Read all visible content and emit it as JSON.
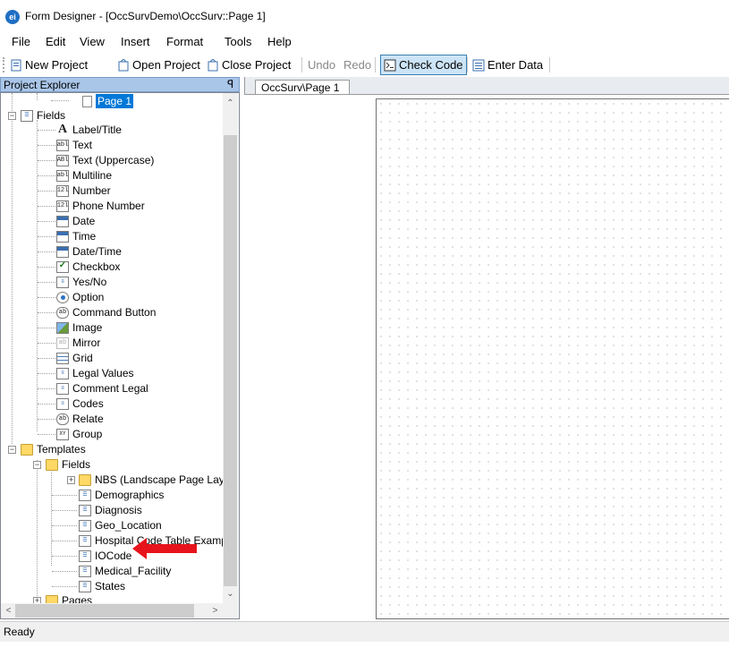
{
  "window": {
    "title": "Form Designer - [OccSurvDemo\\OccSurv::Page 1]",
    "icon_text": "ei"
  },
  "menu": [
    "File",
    "Edit",
    "View",
    "Insert",
    "Format",
    "Tools",
    "Help"
  ],
  "toolbar": {
    "new_project": "New Project",
    "open_project": "Open Project",
    "close_project": "Close Project",
    "undo": "Undo",
    "redo": "Redo",
    "check_code": "Check Code",
    "enter_data": "Enter Data"
  },
  "project_explorer": {
    "title": "Project Explorer",
    "pin": "ꟼ",
    "page_item": "Page 1",
    "fields_label": "Fields",
    "field_items": [
      {
        "icon": "A",
        "label": "Label/Title"
      },
      {
        "icon": "abl",
        "label": "Text"
      },
      {
        "icon": "ABl",
        "label": "Text (Uppercase)"
      },
      {
        "icon": "abl",
        "label": "Multiline"
      },
      {
        "icon": "12l",
        "label": "Number"
      },
      {
        "icon": "12l",
        "label": "Phone Number"
      },
      {
        "icon": "",
        "label": "Date"
      },
      {
        "icon": "",
        "label": "Time"
      },
      {
        "icon": "",
        "label": "Date/Time"
      },
      {
        "icon": "✓",
        "label": "Checkbox"
      },
      {
        "icon": "≡",
        "label": "Yes/No"
      },
      {
        "icon": "",
        "label": "Option"
      },
      {
        "icon": "ab",
        "label": "Command Button"
      },
      {
        "icon": "",
        "label": "Image"
      },
      {
        "icon": "ab",
        "label": "Mirror"
      },
      {
        "icon": "",
        "label": "Grid"
      },
      {
        "icon": "≡",
        "label": "Legal Values"
      },
      {
        "icon": "≡",
        "label": "Comment Legal"
      },
      {
        "icon": "≡",
        "label": "Codes"
      },
      {
        "icon": "ab",
        "label": "Relate"
      },
      {
        "icon": "XY",
        "label": "Group"
      }
    ],
    "templates_label": "Templates",
    "templates_fields_label": "Fields",
    "template_items": [
      "NBS (Landscape Page Layc",
      "Demographics",
      "Diagnosis",
      "Geo_Location",
      "Hospital Code Table Examp",
      "IOCode",
      "Medical_Facility",
      "States"
    ],
    "pages_label": "Pages"
  },
  "design": {
    "tab_label": "OccSurv\\Page 1"
  },
  "status": {
    "text": "Ready"
  },
  "colors": {
    "selection": "#0078d7",
    "header": "#a9c5e8",
    "annotation_arrow": "#e8141b"
  }
}
